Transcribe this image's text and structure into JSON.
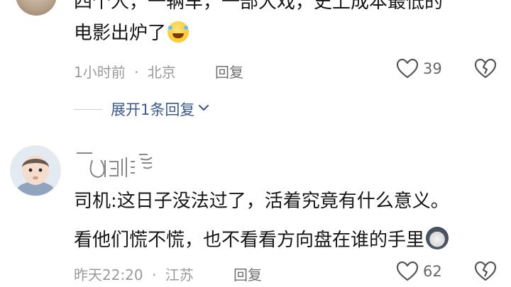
{
  "comment1": {
    "line1": "四个人，一辆车，一部大戏，史上成本最低的",
    "line2": "电影出炉了",
    "time": "1小时前",
    "separator": "·",
    "location": "北京",
    "reply_label": "回复",
    "like_count": "39",
    "expand_replies": "展开1条回复"
  },
  "comment2": {
    "line1": "司机:这日子没法过了，活着究竟有什么意义。",
    "line2": "看他们慌不慌，也不看看方向盘在谁的手里",
    "time": "昨天22:20",
    "separator": "·",
    "location": "江苏",
    "reply_label": "回复",
    "like_count": "62"
  },
  "icons": {
    "like": "heart-outline-icon",
    "dislike": "broken-heart-icon",
    "expand": "chevron-down-icon",
    "emoji1": "laughing-tears-emoji",
    "emoji2": "husky-dog-emoji"
  },
  "colors": {
    "link_blue": "#3b5b8e",
    "meta_gray": "#9a9a9a",
    "text": "#161616"
  }
}
